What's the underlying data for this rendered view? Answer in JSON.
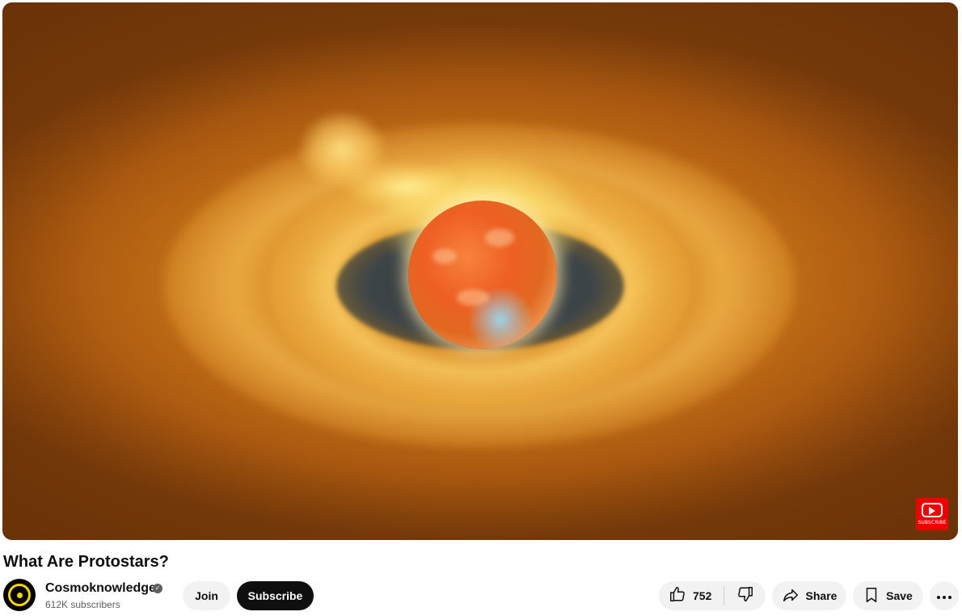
{
  "video": {
    "title": "What Are Protostars?",
    "subscribe_watermark": "SUBSCRIBE"
  },
  "channel": {
    "name": "Cosmoknowledge",
    "subscribers": "612K subscribers",
    "verified": true
  },
  "actions": {
    "join_label": "Join",
    "subscribe_label": "Subscribe",
    "like_count": "752",
    "share_label": "Share",
    "save_label": "Save"
  },
  "icons": {
    "like": "thumbs-up-icon",
    "dislike": "thumbs-down-icon",
    "share": "share-arrow-icon",
    "save": "bookmark-icon",
    "more": "more-horizontal-icon",
    "verified": "checkmark-badge-icon"
  },
  "colors": {
    "subscribe_bg": "#0f0f0f",
    "button_bg": "#f2f2f2",
    "watermark_red": "#ee0000",
    "avatar_accent": "#f5d400"
  }
}
